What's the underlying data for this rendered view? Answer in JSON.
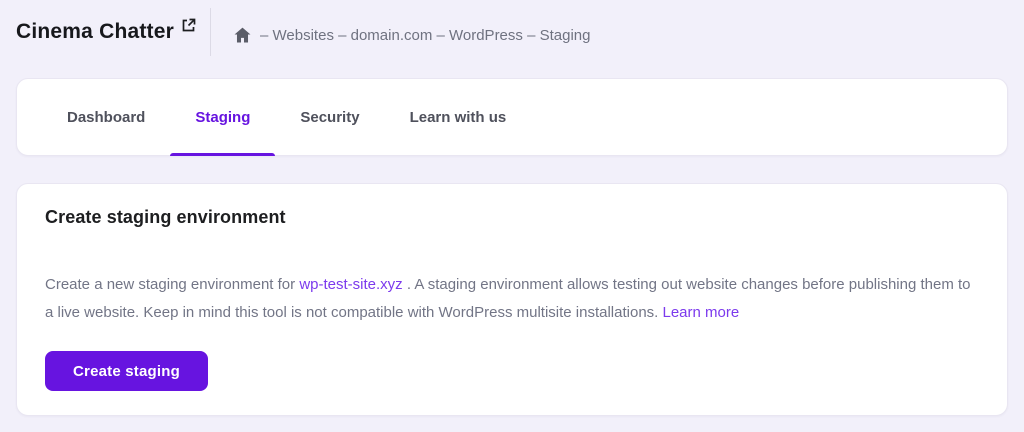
{
  "header": {
    "title": "Cinema Chatter",
    "breadcrumb": "– Websites – domain.com – WordPress – Staging"
  },
  "tabs": {
    "items": [
      {
        "label": "Dashboard",
        "active": false
      },
      {
        "label": "Staging",
        "active": true
      },
      {
        "label": "Security",
        "active": false
      },
      {
        "label": "Learn with us",
        "active": false
      }
    ]
  },
  "staging_card": {
    "title": "Create staging environment",
    "description": {
      "part1": "Create a new staging environment for ",
      "site_link": "wp-test-site.xyz",
      "part2": " . A staging environment allows testing out website changes before publishing them to a live website. Keep in mind this tool is not compatible with WordPress multisite installations. ",
      "learn_more_link": "Learn more"
    },
    "create_button": "Create staging"
  },
  "icons": {
    "external_link": "external-link-icon",
    "home": "home-icon"
  },
  "colors": {
    "accent_purple": "#6714e0",
    "link_purple": "#7c3aed",
    "page_background": "#f2f0fa",
    "card_background": "#ffffff",
    "muted_text": "#727586",
    "dark_text": "#1d1e20",
    "tab_inactive": "#4f515c"
  }
}
